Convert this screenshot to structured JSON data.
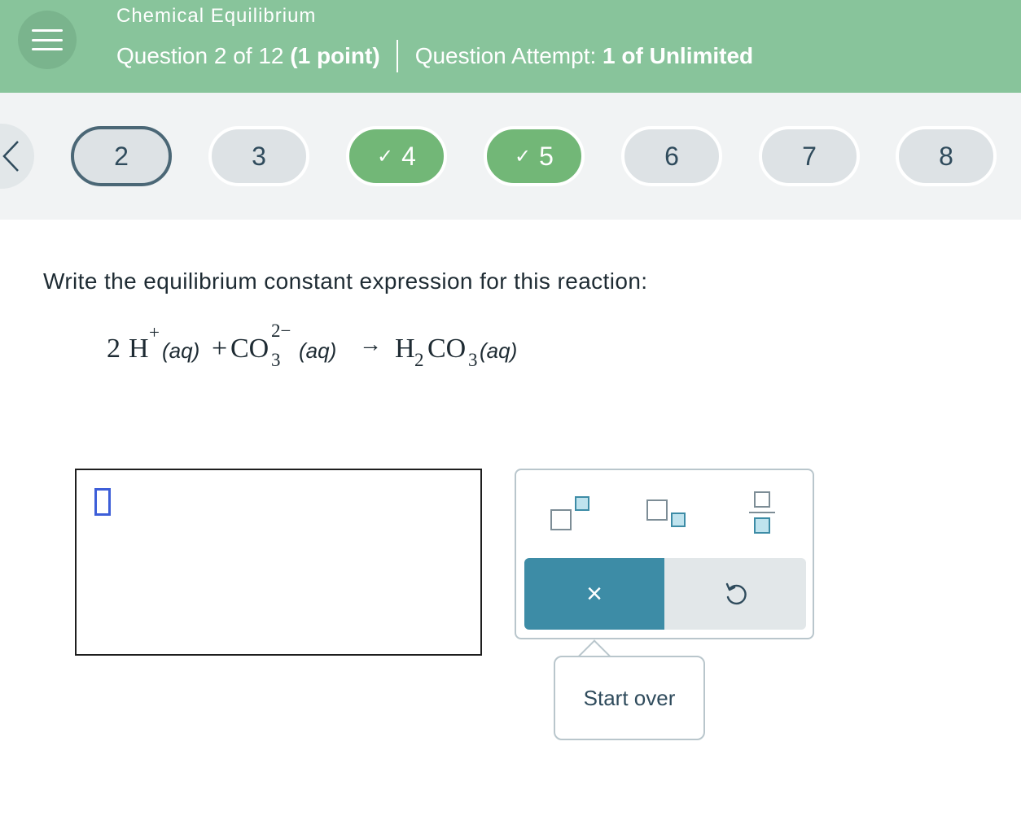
{
  "header": {
    "topic": "Chemical Equilibrium",
    "question_prefix": "Question 2 of 12",
    "question_points": "(1 point)",
    "attempt_prefix": "Question Attempt:",
    "attempt_value": "1 of Unlimited",
    "menu_icon": "hamburger-icon"
  },
  "nav": {
    "prev_icon": "chevron-left-icon",
    "questions": [
      {
        "label": "2",
        "state": "current"
      },
      {
        "label": "3",
        "state": "unanswered"
      },
      {
        "label": "4",
        "state": "correct",
        "mark": "✓"
      },
      {
        "label": "5",
        "state": "correct",
        "mark": "✓"
      },
      {
        "label": "6",
        "state": "unanswered"
      },
      {
        "label": "7",
        "state": "unanswered"
      },
      {
        "label": "8",
        "state": "unanswered"
      }
    ]
  },
  "question": {
    "prompt": "Write the equilibrium constant expression for this reaction:",
    "equation": {
      "coef": "2",
      "r1": "H",
      "r1_charge": "+",
      "r1_state": "(aq)",
      "plus": "+",
      "r2": "CO",
      "r2_sub": "3",
      "r2_charge": "2−",
      "r2_state": "(aq)",
      "arrow": "→",
      "p1_a": "H",
      "p1_sub1": "2",
      "p1_b": "CO",
      "p1_sub2": "3",
      "p1_state": "(aq)"
    }
  },
  "palette": {
    "tools": [
      "superscript-icon",
      "subscript-icon",
      "fraction-icon"
    ],
    "clear_label": "×",
    "undo_icon": "undo-icon"
  },
  "tooltip": {
    "label": "Start over"
  },
  "colors": {
    "header": "#88c49b",
    "correct": "#72b777",
    "accent": "#3d8ca6",
    "text": "#1e2b33"
  }
}
